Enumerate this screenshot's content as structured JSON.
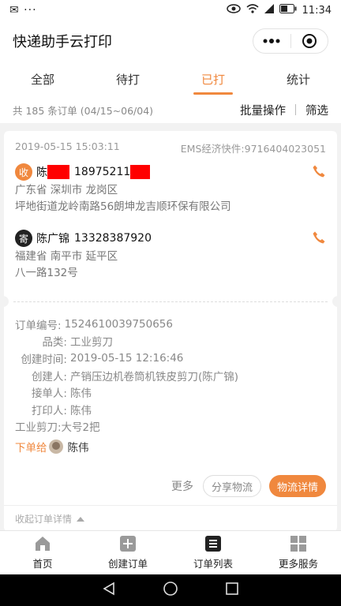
{
  "status_bar": {
    "left": "✉ ···",
    "time": "11:34"
  },
  "header": {
    "title": "快递助手云打印"
  },
  "tabs": [
    {
      "label": "全部",
      "active": false
    },
    {
      "label": "待打",
      "active": false
    },
    {
      "label": "已打",
      "active": true
    },
    {
      "label": "统计",
      "active": false
    }
  ],
  "summary": {
    "count_text": "共 185 条订单 (04/15~06/04)",
    "batch_label": "批量操作",
    "filter_label": "筛选"
  },
  "order": {
    "datetime": "2019-05-15 15:03:11",
    "tracking": "EMS经济快件:9716404023051",
    "receiver": {
      "badge": "收",
      "name": "陈",
      "phone": "18975211",
      "region": "广东省 深圳市 龙岗区",
      "address": "坪地街道龙岭南路56朗坤龙吉顺环保有限公司"
    },
    "sender": {
      "badge": "寄",
      "name": "陈广锦",
      "phone": "13328387920",
      "region": "福建省 南平市 延平区",
      "address": "八一路132号"
    },
    "details": {
      "order_no_label": "订单编号:",
      "order_no": "1524610039750656",
      "category_label": "品类:",
      "category": "工业剪刀",
      "created_label": "创建时间:",
      "created": "2019-05-15 12:16:46",
      "creator_label": "创建人:",
      "creator": "产销压边机卷筒机铁皮剪刀(陈广锦)",
      "receiver_label": "接单人:",
      "receiver": "陈伟",
      "printer_label": "打印人:",
      "printer": "陈伟",
      "item_note": "工业剪刀:大号2把"
    },
    "assign_label": "下单给",
    "assign_name": "陈伟",
    "more_label": "更多",
    "share_label": "分享物流",
    "logistics_label": "物流详情",
    "collapse_label": "收起订单详情"
  },
  "bottom_nav": [
    {
      "label": "首页",
      "icon": "home-icon"
    },
    {
      "label": "创建订单",
      "icon": "plus-square-icon"
    },
    {
      "label": "订单列表",
      "icon": "list-icon"
    },
    {
      "label": "更多服务",
      "icon": "grid-icon"
    }
  ],
  "colors": {
    "accent": "#f0883e",
    "redaction": "#ff0000"
  }
}
